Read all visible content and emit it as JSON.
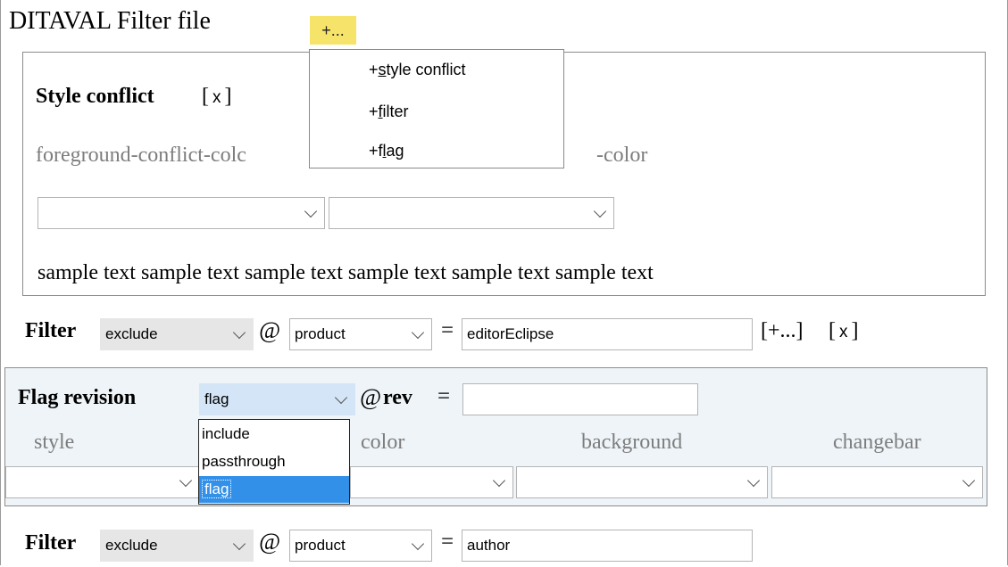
{
  "title": "DITAVAL Filter file",
  "add_menu_button": "+...",
  "add_menu": {
    "items": [
      {
        "prefix": "+",
        "accel": "s",
        "rest": "tyle conflict"
      },
      {
        "prefix": "+",
        "accel": "f",
        "rest": "ilter"
      },
      {
        "prefix": "+f",
        "accel": "l",
        "rest": "ag"
      }
    ]
  },
  "style_conflict": {
    "heading": "Style conflict",
    "remove_bracket_open": "[",
    "remove_x": "x",
    "remove_bracket_close": "]",
    "fg_label": "foreground-conflict-colc",
    "bg_label_suffix": "-color",
    "select1_value": "",
    "select2_value": "",
    "sample_text": "sample text sample text sample text sample text sample text sample text"
  },
  "filter1": {
    "label": "Filter",
    "action": "exclude",
    "at": "@",
    "attribute": "product",
    "equals": "=",
    "value": "editorEclipse",
    "add_link": "[+...]",
    "remove_bracket_open": "[",
    "remove_x": "x",
    "remove_bracket_close": "]"
  },
  "flag": {
    "label": "Flag revision",
    "action": "flag",
    "at": "@",
    "attr_label": "rev",
    "equals": "=",
    "rev_value": "",
    "columns": {
      "style": "style",
      "color": "color",
      "background": "background",
      "changebar": "changebar"
    },
    "action_options": [
      "include",
      "passthrough",
      "flag"
    ],
    "selected_option_index": 2
  },
  "filter2": {
    "label": "Filter",
    "action": "exclude",
    "at": "@",
    "attribute": "product",
    "equals": "=",
    "value": "author"
  }
}
